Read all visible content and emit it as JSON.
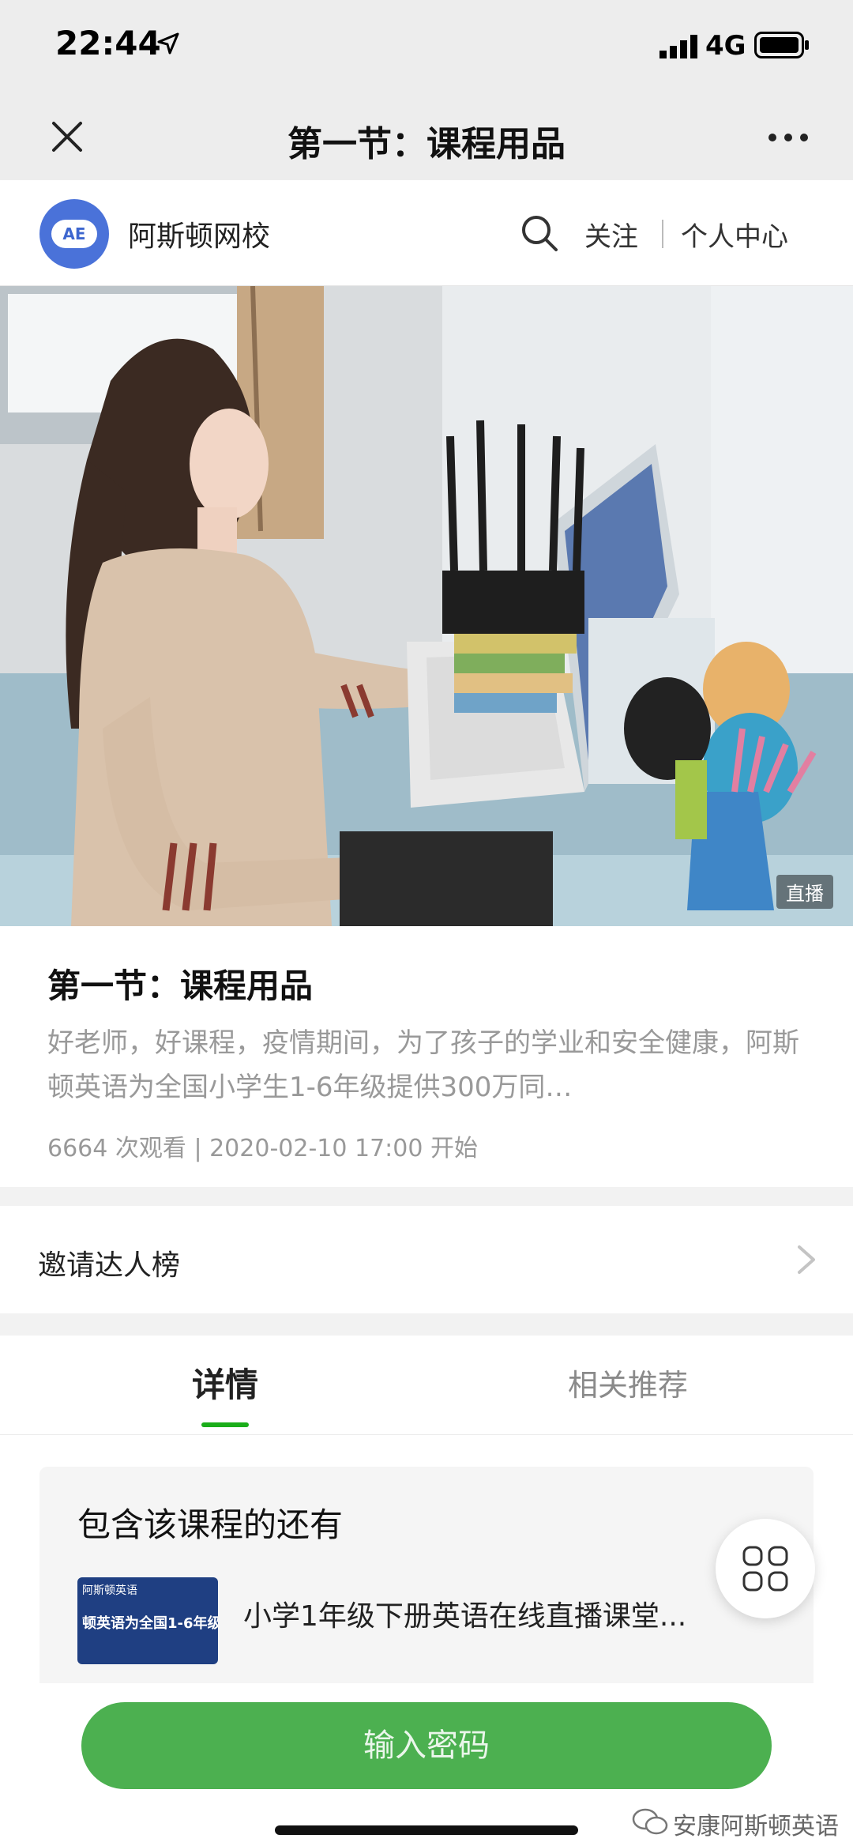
{
  "status_bar": {
    "time": "22:44",
    "network": "4G"
  },
  "nav": {
    "title": "第一节：课程用品"
  },
  "channel": {
    "logo_text": "AE",
    "name": "阿斯顿网校",
    "follow": "关注",
    "center": "个人中心"
  },
  "hero": {
    "badge": "直播"
  },
  "course": {
    "title": "第一节：课程用品",
    "description": "好老师，好课程，疫情期间，为了孩子的学业和安全健康，阿斯顿英语为全国小学生1-6年级提供300万同…",
    "views": "6664 次观看",
    "separator": "|",
    "start_time": "2020-02-10 17:00 开始"
  },
  "invite": {
    "label": "邀请达人榜"
  },
  "tabs": [
    {
      "label": "详情",
      "active": true
    },
    {
      "label": "相关推荐",
      "active": false
    }
  ],
  "bundle": {
    "title": "包含该课程的还有",
    "item": {
      "thumb_line1": "阿斯顿英语",
      "thumb_line2": "顿英语为全国1-6年级",
      "title": "小学1年级下册英语在线直播课堂..."
    }
  },
  "bottom": {
    "button_label": "输入密码",
    "watermark": "安康阿斯顿英语"
  },
  "colors": {
    "accent_green": "#1aad19",
    "button_green": "#4cb050",
    "logo_blue": "#4a72d9"
  },
  "icons": [
    "location-arrow-icon",
    "signal-icon",
    "battery-icon",
    "close-icon",
    "more-icon",
    "search-icon",
    "chevron-right-icon",
    "apps-icon",
    "wechat-icon"
  ]
}
